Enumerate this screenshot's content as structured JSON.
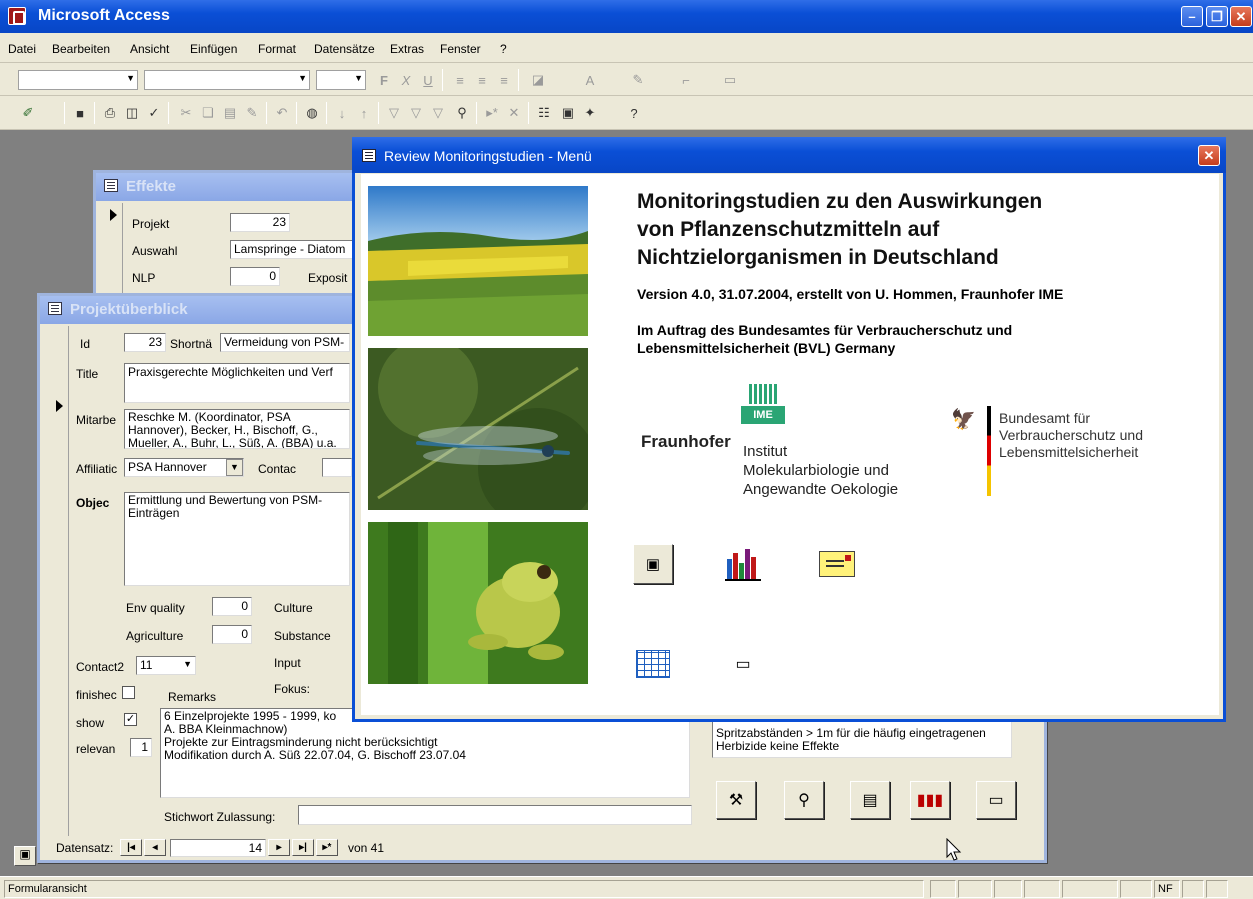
{
  "app": {
    "title": "Microsoft Access"
  },
  "menu": [
    "Datei",
    "Bearbeiten",
    "Ansicht",
    "Einfügen",
    "Format",
    "Datensätze",
    "Extras",
    "Fenster",
    "?"
  ],
  "effekte": {
    "title": "Effekte",
    "projekt_label": "Projekt",
    "projekt_value": "23",
    "auswahl_label": "Auswahl",
    "auswahl_value": "Lamspringe - Diatom",
    "nlp_label": "NLP",
    "nlp_value": "0",
    "exposit_label": "Exposit"
  },
  "projekt": {
    "title": "Projektüberblick",
    "id_label": "Id",
    "id_value": "23",
    "short_label": "Shortnä",
    "short_value": "Vermeidung von PSM-",
    "title_label": "Title",
    "title_value": "Praxisgerechte Möglichkeiten und Verf",
    "mitarbe_label": "Mitarbe",
    "mitarbe_value": "Reschke M. (Koordinator, PSA Hannover), Becker, H., Bischoff, G., Mueller, A., Buhr, L., Süß, A. (BBA) u.a.",
    "affiliatic_label": "Affiliatic",
    "affiliatic_value": "PSA Hannover",
    "contac_label": "Contac",
    "object_label": "Objec",
    "object_value": "Ermittlung und Bewertung von PSM-Einträgen",
    "env_label": "Env quality",
    "env_value": "0",
    "culture_label": "Culture",
    "agri_label": "Agriculture",
    "agri_value": "0",
    "substance_label": "Substance",
    "input_label": "Input",
    "fokus_label": "Fokus:",
    "contact2_label": "Contact2",
    "contact2_value": "11",
    "finished_label": "finishec",
    "remarks_label": "Remarks",
    "show_label": "show",
    "relevan_label": "relevan",
    "relevan_value": "1",
    "remarks_lines": [
      "6 Einzelprojekte 1995 - 1999, ko",
      "A. BBA Kleinmachnow)",
      "Projekte zur Eintragsminderung nicht berücksichtigt",
      "Modifikation durch A. Süß 22.07.04, G. Bischoff 23.07.04"
    ],
    "right_text": "Spritzabständen > 1m für die häufig eingetragenen Herbizide keine Effekte",
    "stichwort_label": "Stichwort Zulassung:",
    "nav_label": "Datensatz:",
    "nav_record": "14",
    "nav_total": "von  41"
  },
  "review": {
    "title": "Review Monitoringstudien - Menü",
    "heading_lines": [
      "Monitoringstudien zu den Auswirkungen",
      "von Pflanzenschutzmitteln auf",
      "Nichtzielorganismen in Deutschland"
    ],
    "version": "Version 4.0, 31.07.2004, erstellt von U. Hommen, Fraunhofer IME",
    "auftrag_lines": [
      "Im Auftrag des Bundesamtes für Verbraucherschutz und",
      "Lebensmittelsicherheit (BVL) Germany"
    ],
    "ime_logo": "IME",
    "fraunhofer": "Fraunhofer",
    "institut_lines": [
      "Institut",
      "Molekularbiologie und",
      "Angewandte Oekologie"
    ],
    "bvl_lines": [
      "Bundesamt für",
      "Verbraucherschutz und",
      "Lebensmittelsicherheit"
    ]
  },
  "statusbar": {
    "text": "Formularansicht",
    "nf": "NF"
  },
  "colors": {
    "titlebar": "#0a4fd6",
    "mdi": "#808080",
    "chrome": "#ece9d8"
  }
}
